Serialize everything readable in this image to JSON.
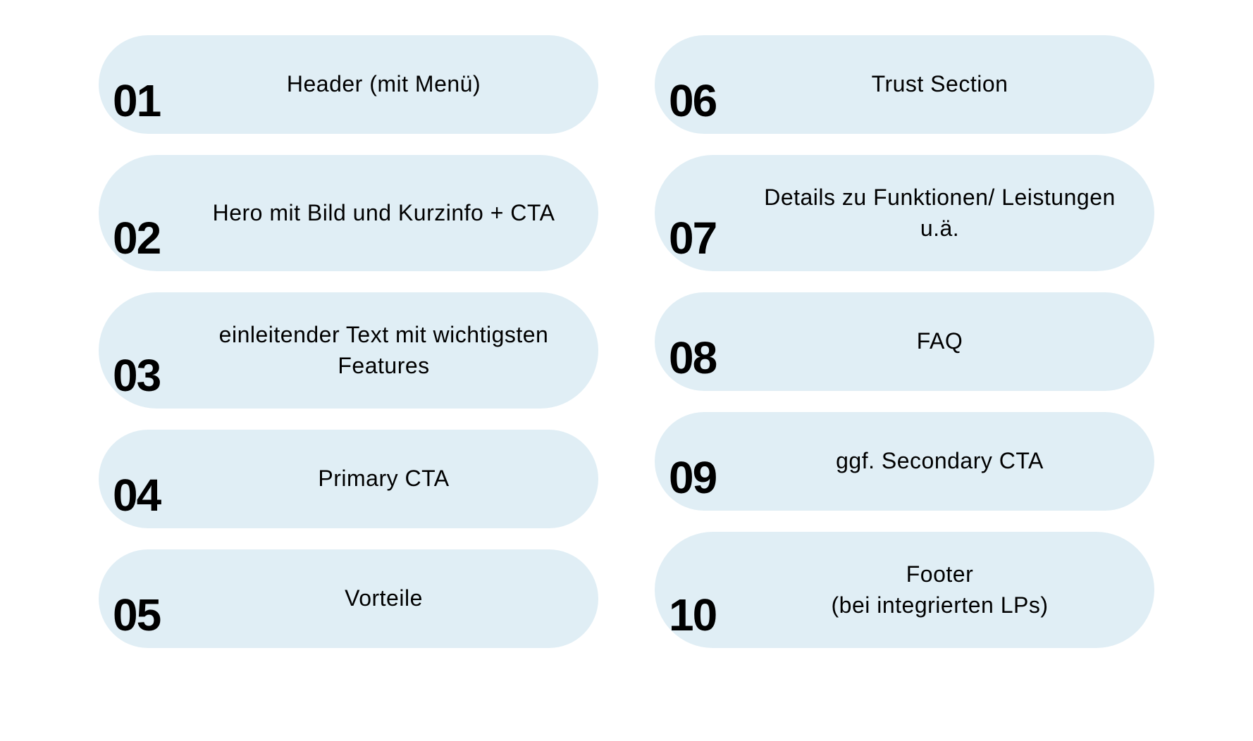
{
  "items": [
    {
      "num": "01",
      "label": "Header (mit Menü)"
    },
    {
      "num": "02",
      "label": "Hero mit Bild und Kurzinfo + CTA"
    },
    {
      "num": "03",
      "label": "einleitender Text mit wichtigsten Features"
    },
    {
      "num": "04",
      "label": "Primary CTA"
    },
    {
      "num": "05",
      "label": "Vorteile"
    },
    {
      "num": "06",
      "label": "Trust Section"
    },
    {
      "num": "07",
      "label": "Details zu Funktionen/ Leistungen u.ä."
    },
    {
      "num": "08",
      "label": "FAQ"
    },
    {
      "num": "09",
      "label": "ggf. Secondary CTA"
    },
    {
      "num": "10",
      "label": "Footer\n(bei integrierten LPs)"
    }
  ]
}
